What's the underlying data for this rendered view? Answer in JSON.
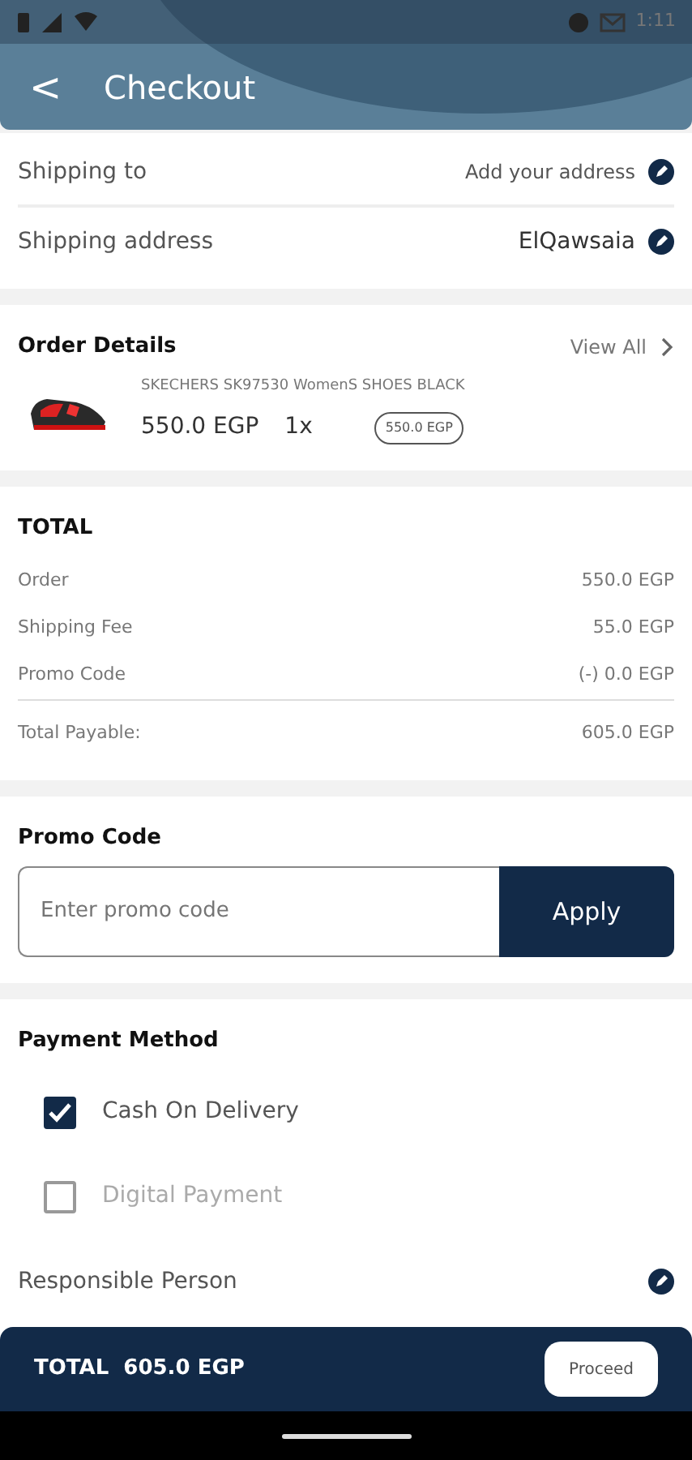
{
  "status_bar": {
    "time": "1:11"
  },
  "app_bar": {
    "back": "<",
    "title": "Checkout"
  },
  "shipping": [
    {
      "label": "Shipping to",
      "value": "Add your address"
    },
    {
      "label": "Shipping address",
      "value": "ElQawsaia"
    }
  ],
  "order_details": {
    "title": "Order Details",
    "view_all": "View All",
    "items": [
      {
        "name": "SKECHERS SK97530 WomenS SHOES BLACK",
        "price": "550.0 EGP",
        "quantity": "1x",
        "total": "550.0 EGP"
      }
    ]
  },
  "total": {
    "title": "TOTAL",
    "rows": [
      {
        "label": "Order",
        "value": "550.0 EGP"
      },
      {
        "label": "Shipping Fee",
        "value": "55.0 EGP"
      },
      {
        "label": "Promo Code",
        "value": "(-) 0.0 EGP"
      }
    ],
    "payable": {
      "label": "Total Payable:",
      "value": "605.0 EGP"
    }
  },
  "promo": {
    "title": "Promo Code",
    "placeholder": "Enter promo code",
    "button": "Apply"
  },
  "payment": {
    "title": "Payment Method",
    "options": [
      {
        "label": "Cash On Delivery",
        "checked": true
      },
      {
        "label": "Digital Payment",
        "checked": false
      }
    ]
  },
  "responsible": {
    "label": "Responsible Person"
  },
  "bottom_bar": {
    "total": "TOTAL  605.0 EGP",
    "button": "Proceed"
  }
}
